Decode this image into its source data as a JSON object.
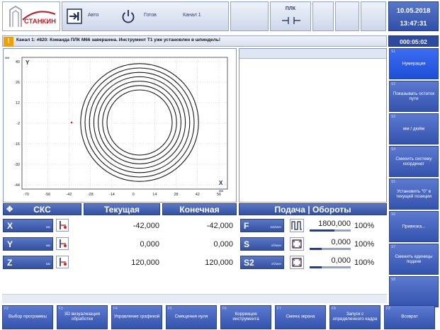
{
  "header": {
    "logo_text": "СТАНКИН",
    "mode": {
      "auto_label": "Авто",
      "ready_label": "Готов",
      "channel_label": "Канал 1"
    },
    "plc_label": "ПЛК",
    "date": "10.05.2018",
    "time": "13:47:31",
    "timer": "000:05:02"
  },
  "message": {
    "icon": "warning-icon",
    "text": "Канал 1: #820: Команда ПЛК M66 завершена. Инструмент T1 уже установлен в шпиндель!"
  },
  "plot": {
    "y_label": "Y",
    "x_label": "X",
    "y_unit": "мм",
    "x_unit": "мм",
    "y_ticks": [
      "40",
      "26",
      "12",
      "-2",
      "-16",
      "-30",
      "-44"
    ],
    "x_ticks": [
      "-70",
      "-56",
      "-42",
      "-28",
      "-14",
      "0",
      "14",
      "28",
      "42",
      "56"
    ],
    "circle_count": 7,
    "grid": true,
    "marker_color": "#e03030",
    "trace_color": "#101010"
  },
  "axis_table": {
    "headers": {
      "system": "СКС",
      "current": "Текущая",
      "final": "Конечная"
    },
    "axes": [
      {
        "name": "X",
        "unit": "мм",
        "current": "-42,000",
        "final": "-42,000"
      },
      {
        "name": "Y",
        "unit": "мм",
        "current": "0,000",
        "final": "0,000"
      },
      {
        "name": "Z",
        "unit": "мм",
        "current": "120,000",
        "final": "120,000"
      }
    ]
  },
  "feed_table": {
    "header": "Подача | Обороты",
    "rows": [
      {
        "name": "F",
        "unit": "мм/мин",
        "value": "1800,000",
        "percent": "100%",
        "bar_fill": 0.6
      },
      {
        "name": "S",
        "unit": "об/мин",
        "value": "0,000",
        "percent": "100%",
        "bar_fill": 0.3
      },
      {
        "name": "S2",
        "unit": "об/мин",
        "value": "0,000",
        "percent": "100%",
        "bar_fill": 0.3
      }
    ]
  },
  "right_softkeys": [
    {
      "num": "S1",
      "label": "Нумерация",
      "active": true
    },
    {
      "num": "S2",
      "label": "Показывать остаток пути",
      "active": false
    },
    {
      "num": "S3",
      "label": "мм / дюйм",
      "active": false
    },
    {
      "num": "S4",
      "label": "Сменить систему координат",
      "active": false
    },
    {
      "num": "S5",
      "label": "Установить \"0\" в текущей позиции",
      "active": false
    },
    {
      "num": "S6",
      "label": "Привязка...",
      "active": false
    },
    {
      "num": "S7",
      "label": "Сменить единицы подачи",
      "active": false
    },
    {
      "num": "S8",
      "label": "",
      "active": false
    }
  ],
  "bottom_softkeys": [
    {
      "num": "F2",
      "label": "Выбор программы"
    },
    {
      "num": "F3",
      "label": "3D визуализация обработки"
    },
    {
      "num": "F4",
      "label": "Управление графикой"
    },
    {
      "num": "F5",
      "label": "Смещения нуля"
    },
    {
      "num": "F6",
      "label": "Коррекция инструмента"
    },
    {
      "num": "F7",
      "label": "Смена экрана"
    },
    {
      "num": "F8",
      "label": "Запуск с определенного кадра"
    },
    {
      "num": "F9",
      "label": "Возврат"
    }
  ]
}
